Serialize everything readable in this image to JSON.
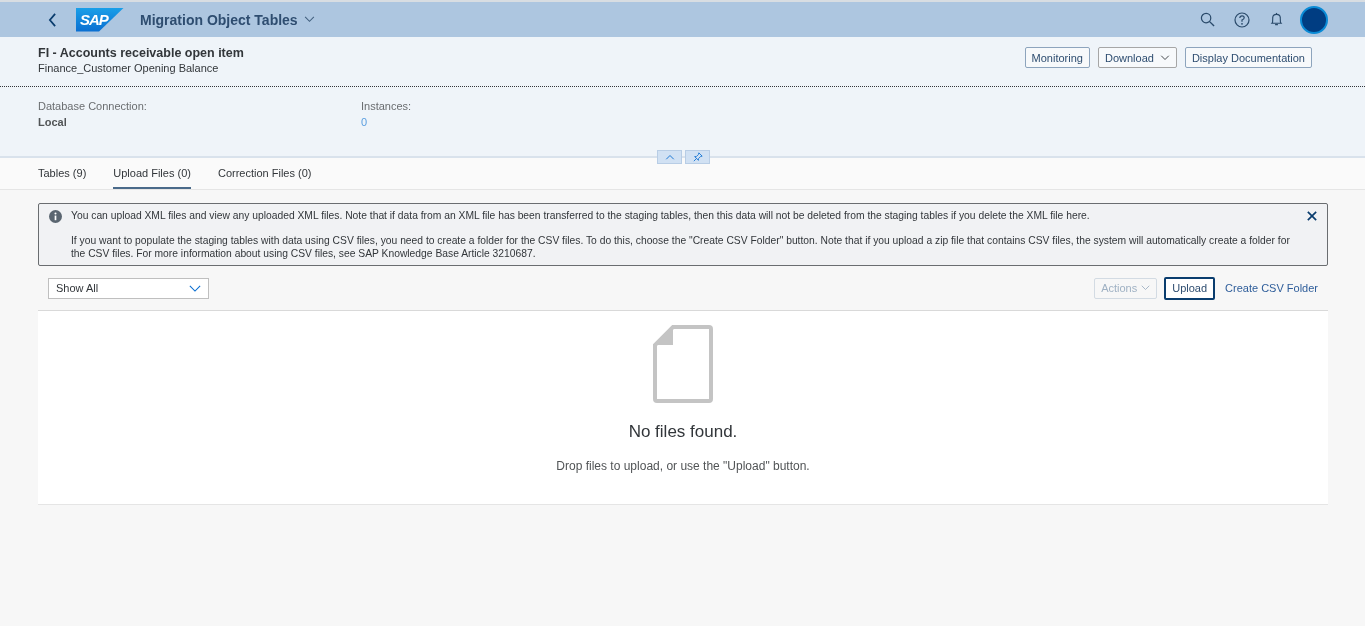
{
  "shell": {
    "logo": "SAP",
    "title": "Migration Object Tables"
  },
  "header": {
    "title": "FI - Accounts receivable open item",
    "subtitle": "Finance_Customer Opening Balance",
    "actions": [
      {
        "label": "Monitoring",
        "kind": "button"
      },
      {
        "label": "Download",
        "kind": "menu"
      },
      {
        "label": "Display Documentation",
        "kind": "button"
      }
    ],
    "attributes": [
      {
        "label": "Database Connection:",
        "value": "Local",
        "kind": "text"
      },
      {
        "label": "Instances:",
        "value": "0",
        "kind": "link"
      }
    ]
  },
  "tabs": [
    {
      "label": "Tables (9)",
      "selected": false
    },
    {
      "label": "Upload Files (0)",
      "selected": true
    },
    {
      "label": "Correction Files (0)",
      "selected": false
    }
  ],
  "message": {
    "paragraphs": [
      "You can upload XML files and view any uploaded XML files. Note that if data from an XML file has been transferred to the staging tables, then this data will not be deleted from the staging tables if you delete the XML file here.",
      "If you want to populate the staging tables with data using CSV files, you need to create a folder for the CSV files. To do this, choose the \"Create CSV Folder\" button. Note that if you upload a zip file that contains CSV files, the system will automatically create a folder for the CSV files. For more information about using CSV files, see SAP Knowledge Base Article 3210687."
    ]
  },
  "filter": {
    "value": "Show All"
  },
  "toolbar": [
    {
      "label": "Actions",
      "kind": "menu",
      "disabled": true
    },
    {
      "label": "Upload",
      "kind": "button",
      "disabled": false
    },
    {
      "label": "Create CSV Folder",
      "kind": "link",
      "disabled": false
    }
  ],
  "empty": {
    "title": "No files found.",
    "description": "Drop files to upload, or use the \"Upload\" button."
  }
}
